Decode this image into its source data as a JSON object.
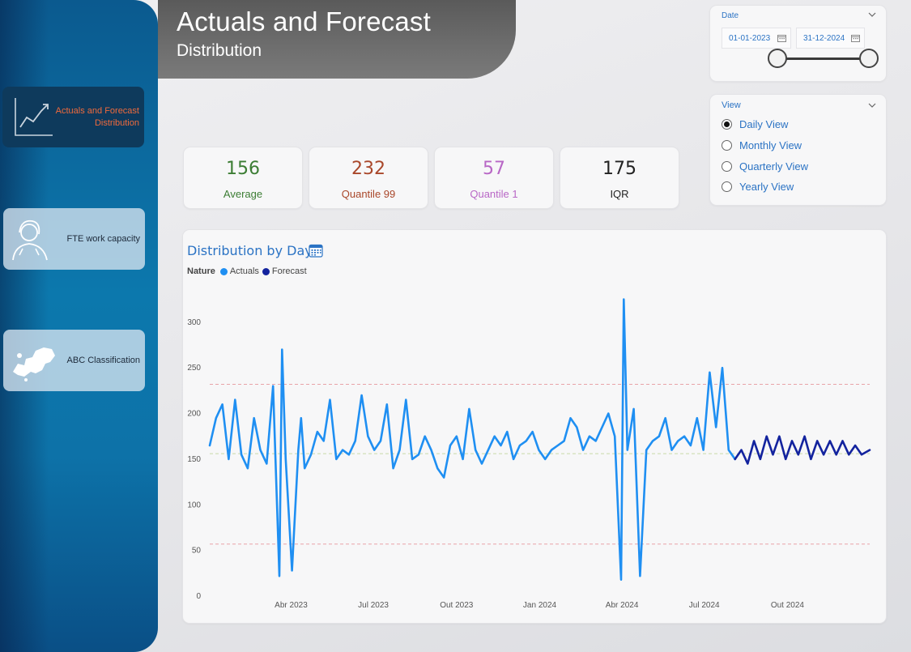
{
  "header": {
    "title": "Actuals and Forecast",
    "subtitle": "Distribution"
  },
  "sidebar": {
    "items": [
      {
        "label": "Actuals and Forecast Distribution",
        "icon": "trend-chart-icon",
        "active": true
      },
      {
        "label": "FTE work capacity",
        "icon": "worker-icon",
        "active": false
      },
      {
        "label": "ABC Classification",
        "icon": "europe-map-icon",
        "active": false
      }
    ]
  },
  "date_slicer": {
    "label": "Date",
    "start": "01-01-2023",
    "end": "31-12-2024"
  },
  "view_slicer": {
    "label": "View",
    "options": [
      "Daily View",
      "Monthly View",
      "Quarterly View",
      "Yearly View"
    ],
    "selected": "Daily View"
  },
  "kpis": [
    {
      "value": "156",
      "label": "Average",
      "color": "#3c7d34"
    },
    {
      "value": "232",
      "label": "Quantile 99",
      "color": "#a9472a"
    },
    {
      "value": "57",
      "label": "Quantile 1",
      "color": "#b867c6"
    },
    {
      "value": "175",
      "label": "IQR",
      "color": "#222222"
    }
  ],
  "chart": {
    "title": "Distribution by Day",
    "legend_title": "Nature",
    "colors": {
      "actuals": "#1f8ff2",
      "forecast": "#13239e",
      "ref_high": "#e8a3a8",
      "ref_mid": "#c8d9a8",
      "ref_low": "#e8a3a8"
    }
  },
  "chart_data": {
    "type": "line",
    "title": "Distribution by Day",
    "legend": [
      "Actuals",
      "Forecast"
    ],
    "x_ticks": [
      "Abr 2023",
      "Jul 2023",
      "Out 2023",
      "Jan 2024",
      "Abr 2024",
      "Jul 2024",
      "Out 2024"
    ],
    "x_range": [
      "2023-01-01",
      "2024-12-31"
    ],
    "ylim": [
      0,
      330
    ],
    "y_ticks": [
      0,
      50,
      100,
      150,
      200,
      250,
      300
    ],
    "reference_lines": [
      {
        "value": 232
      },
      {
        "value": 156
      },
      {
        "value": 57
      }
    ],
    "series": [
      {
        "name": "Actuals",
        "x": [
          "2023-01-01",
          "2023-01-08",
          "2023-01-15",
          "2023-01-22",
          "2023-01-29",
          "2023-02-05",
          "2023-02-12",
          "2023-02-19",
          "2023-02-26",
          "2023-03-05",
          "2023-03-12",
          "2023-03-19",
          "2023-03-22",
          "2023-03-26",
          "2023-04-02",
          "2023-04-09",
          "2023-04-12",
          "2023-04-16",
          "2023-04-23",
          "2023-04-30",
          "2023-05-07",
          "2023-05-14",
          "2023-05-21",
          "2023-05-28",
          "2023-06-04",
          "2023-06-11",
          "2023-06-18",
          "2023-06-25",
          "2023-07-02",
          "2023-07-09",
          "2023-07-16",
          "2023-07-23",
          "2023-07-30",
          "2023-08-06",
          "2023-08-13",
          "2023-08-20",
          "2023-08-27",
          "2023-09-03",
          "2023-09-10",
          "2023-09-17",
          "2023-09-24",
          "2023-10-01",
          "2023-10-08",
          "2023-10-15",
          "2023-10-22",
          "2023-10-29",
          "2023-11-05",
          "2023-11-12",
          "2023-11-19",
          "2023-11-26",
          "2023-12-03",
          "2023-12-10",
          "2023-12-17",
          "2023-12-24",
          "2023-12-31",
          "2024-01-07",
          "2024-01-14",
          "2024-01-21",
          "2024-01-28",
          "2024-02-04",
          "2024-02-11",
          "2024-02-18",
          "2024-02-25",
          "2024-03-03",
          "2024-03-10",
          "2024-03-17",
          "2024-03-24",
          "2024-03-31",
          "2024-04-03",
          "2024-04-07",
          "2024-04-14",
          "2024-04-21",
          "2024-04-28",
          "2024-05-05",
          "2024-05-12",
          "2024-05-19",
          "2024-05-26",
          "2024-06-02",
          "2024-06-09",
          "2024-06-16",
          "2024-06-23",
          "2024-06-30",
          "2024-07-07",
          "2024-07-14",
          "2024-07-21",
          "2024-07-28",
          "2024-08-04"
        ],
        "values": [
          165,
          195,
          210,
          150,
          215,
          155,
          140,
          195,
          160,
          145,
          230,
          22,
          270,
          150,
          28,
          160,
          195,
          140,
          155,
          180,
          170,
          215,
          150,
          160,
          155,
          170,
          220,
          175,
          160,
          170,
          210,
          140,
          160,
          215,
          150,
          155,
          175,
          160,
          140,
          130,
          165,
          175,
          150,
          205,
          160,
          145,
          160,
          175,
          165,
          180,
          150,
          165,
          170,
          180,
          160,
          150,
          160,
          165,
          170,
          195,
          185,
          160,
          175,
          170,
          185,
          200,
          175,
          18,
          325,
          160,
          205,
          22,
          160,
          170,
          175,
          195,
          160,
          170,
          175,
          165,
          195,
          160,
          245,
          185,
          250,
          160,
          150
        ]
      },
      {
        "name": "Forecast",
        "x": [
          "2024-08-04",
          "2024-08-11",
          "2024-08-18",
          "2024-08-25",
          "2024-09-01",
          "2024-09-08",
          "2024-09-15",
          "2024-09-22",
          "2024-09-29",
          "2024-10-06",
          "2024-10-13",
          "2024-10-20",
          "2024-10-27",
          "2024-11-03",
          "2024-11-10",
          "2024-11-17",
          "2024-11-24",
          "2024-12-01",
          "2024-12-08",
          "2024-12-15",
          "2024-12-22",
          "2024-12-31"
        ],
        "values": [
          150,
          160,
          145,
          170,
          150,
          175,
          155,
          175,
          150,
          170,
          155,
          175,
          150,
          170,
          155,
          170,
          155,
          170,
          155,
          165,
          155,
          160
        ]
      }
    ]
  }
}
